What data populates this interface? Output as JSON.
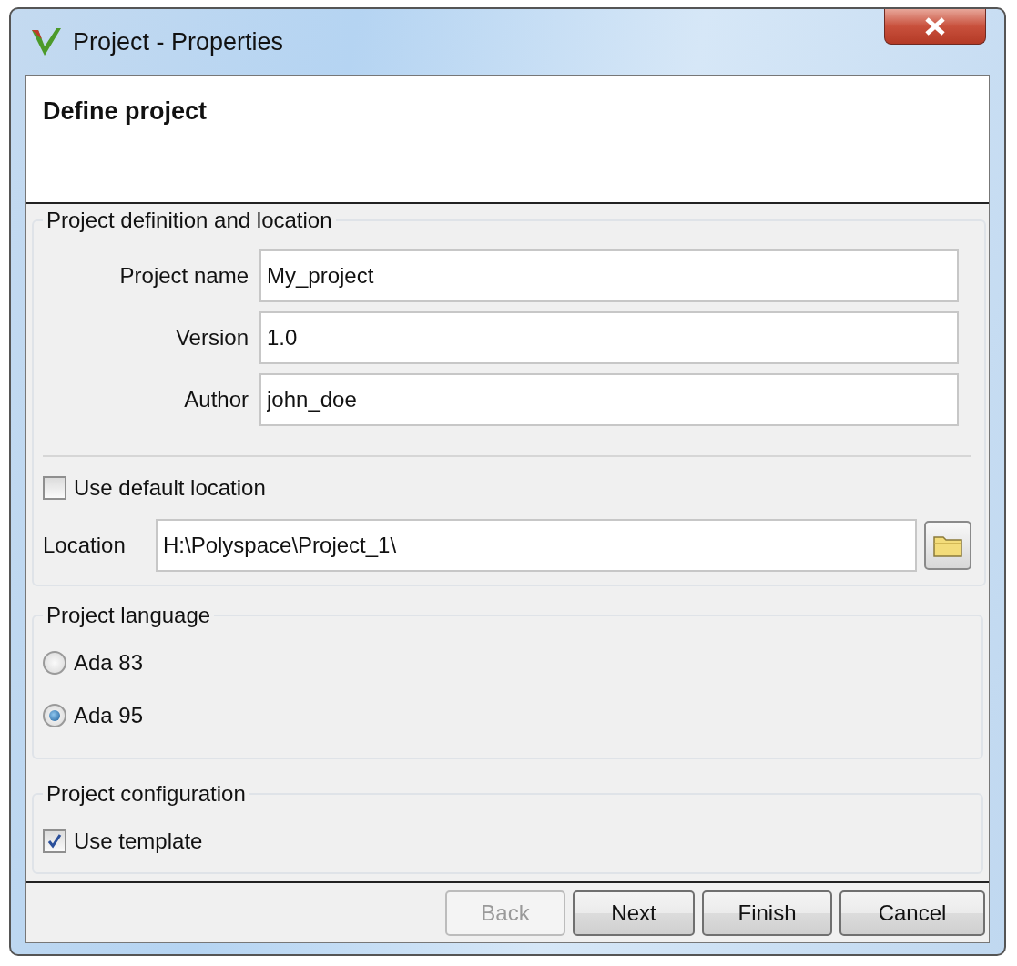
{
  "window": {
    "title": "Project - Properties"
  },
  "header": {
    "title": "Define project"
  },
  "groups": [
    {
      "kind": "definition",
      "title": "Project definition and location",
      "fields": [
        {
          "label": "Project name",
          "value": "My_project"
        },
        {
          "label": "Version",
          "value": "1.0"
        },
        {
          "label": "Author",
          "value": "john_doe"
        }
      ],
      "default_location": {
        "label": "Use default location",
        "checked": false
      },
      "location": {
        "label": "Location",
        "value": "H:\\Polyspace\\Project_1\\"
      }
    },
    {
      "kind": "radios",
      "title": "Project language",
      "options": [
        {
          "label": "Ada 83",
          "selected": false
        },
        {
          "label": "Ada 95",
          "selected": true
        }
      ]
    },
    {
      "kind": "checks",
      "title": "Project configuration",
      "options": [
        {
          "label": "Use template",
          "checked": true
        }
      ]
    }
  ],
  "buttons": [
    {
      "label": "Back",
      "disabled": true
    },
    {
      "label": "Next",
      "disabled": false
    },
    {
      "label": "Finish",
      "disabled": false
    },
    {
      "label": "Cancel",
      "disabled": false
    }
  ]
}
